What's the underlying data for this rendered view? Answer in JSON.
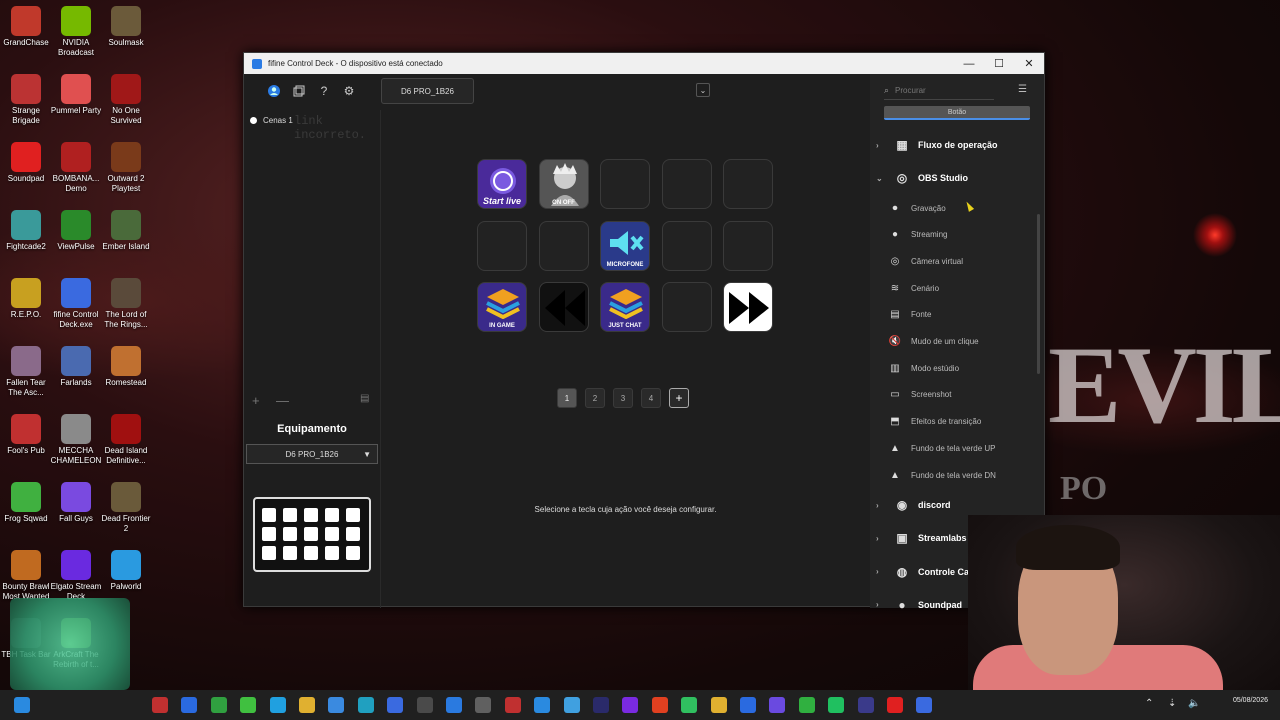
{
  "desktop_icons": [
    {
      "label": "GrandChase",
      "color": "#c0392b"
    },
    {
      "label": "NVIDIA Broadcast",
      "color": "#76b900"
    },
    {
      "label": "Soulmask",
      "color": "#6b5a3a"
    },
    {
      "label": "Strange Brigade",
      "color": "#b33"
    },
    {
      "label": "Pummel Party",
      "color": "#e05050"
    },
    {
      "label": "No One Survived",
      "color": "#a01818"
    },
    {
      "label": "Soundpad",
      "color": "#e02020"
    },
    {
      "label": "BOMBANA... Demo",
      "color": "#b02020"
    },
    {
      "label": "Outward 2 Playtest",
      "color": "#7a3a1a"
    },
    {
      "label": "Fightcade2",
      "color": "#3a9a9a"
    },
    {
      "label": "ViewPulse",
      "color": "#2a8a2a"
    },
    {
      "label": "Ember Island",
      "color": "#4a6a3a"
    },
    {
      "label": "R.E.P.O.",
      "color": "#c8a020"
    },
    {
      "label": "fifine Control Deck.exe",
      "color": "#3a6ae0"
    },
    {
      "label": "The Lord of The Rings...",
      "color": "#5a4a3a"
    },
    {
      "label": "Fallen Tear The Asc...",
      "color": "#8a6a8a"
    },
    {
      "label": "Farlands",
      "color": "#4a6ab0"
    },
    {
      "label": "Romestead",
      "color": "#c07030"
    },
    {
      "label": "Fool's Pub",
      "color": "#c03030"
    },
    {
      "label": "MECCHA CHAMELEON",
      "color": "#8a8a8a"
    },
    {
      "label": "Dead Island Definitive...",
      "color": "#a01010"
    },
    {
      "label": "Frog Sqwad",
      "color": "#40b040"
    },
    {
      "label": "Fall Guys",
      "color": "#7a4ae0"
    },
    {
      "label": "Dead Frontier 2",
      "color": "#6a5a3a"
    },
    {
      "label": "Bounty Brawl Most Wanted",
      "color": "#c06a20"
    },
    {
      "label": "Elgato Stream Deck",
      "color": "#6a2ae0"
    },
    {
      "label": "Palworld",
      "color": "#2a9ae0"
    },
    {
      "label": "TBH Task Bar",
      "color": "#3a3a3a"
    },
    {
      "label": "ArkCraft The Rebirth of t...",
      "color": "#6a9a3a"
    }
  ],
  "window": {
    "title": "fifine Control Deck - O dispositivo está conectado",
    "controls": {
      "minimize": "—",
      "maximize": "☐",
      "close": "✕"
    }
  },
  "toolbar": {
    "icons": [
      "profile-icon",
      "layers-icon",
      "help-icon",
      "settings-icon"
    ],
    "device_tab": "D6 PRO_1B26",
    "dropdown_icon": "chevron-down-icon"
  },
  "scenes": {
    "items": [
      "Cenas 1"
    ],
    "ghost_text": "link incorreto."
  },
  "scene_actions": {
    "add": "+",
    "remove": "—"
  },
  "equipment": {
    "heading": "Equipamento",
    "device": "D6 PRO_1B26"
  },
  "keys": [
    {
      "label": "Start live",
      "color": "#4a2a9a",
      "icon": "obs-icon"
    },
    {
      "label": "ON OFF",
      "color": "#555",
      "icon": "avatar-icon"
    },
    {
      "label": "",
      "color": "",
      "icon": ""
    },
    {
      "label": "",
      "color": "",
      "icon": ""
    },
    {
      "label": "",
      "color": "",
      "icon": ""
    },
    {
      "label": "",
      "color": "",
      "icon": ""
    },
    {
      "label": "",
      "color": "",
      "icon": ""
    },
    {
      "label": "MICROFONE",
      "color": "#2a3a8a",
      "icon": "mute-icon"
    },
    {
      "label": "",
      "color": "",
      "icon": ""
    },
    {
      "label": "",
      "color": "",
      "icon": ""
    },
    {
      "label": "IN GAME",
      "color": "#3a2a8a",
      "icon": "layers-icon"
    },
    {
      "label": "",
      "color": "#111",
      "icon": "rewind-icon"
    },
    {
      "label": "JUST CHAT",
      "color": "#3a2a8a",
      "icon": "layers-icon"
    },
    {
      "label": "",
      "color": "",
      "icon": ""
    },
    {
      "label": "",
      "color": "#fff",
      "icon": "fast-forward-icon"
    }
  ],
  "pager": {
    "pages": [
      "1",
      "2",
      "3",
      "4"
    ],
    "active": 1,
    "add": "+"
  },
  "hint": "Selecione a tecla cuja ação você deseja configurar.",
  "sidebar": {
    "search_placeholder": "Procurar",
    "category_tab": "Botão",
    "groups": [
      {
        "label": "Fluxo de operação",
        "expanded": false,
        "icon": "flow-icon"
      },
      {
        "label": "OBS Studio",
        "expanded": true,
        "icon": "obs-icon"
      }
    ],
    "obs_items": [
      {
        "label": "Gravação",
        "icon": "record-icon"
      },
      {
        "label": "Streaming",
        "icon": "broadcast-icon"
      },
      {
        "label": "Câmera virtual",
        "icon": "camera-icon"
      },
      {
        "label": "Cenário",
        "icon": "layers-icon"
      },
      {
        "label": "Fonte",
        "icon": "source-icon"
      },
      {
        "label": "Mudo de um clique",
        "icon": "mute-icon"
      },
      {
        "label": "Modo estúdio",
        "icon": "studio-icon"
      },
      {
        "label": "Screenshot",
        "icon": "screenshot-icon"
      },
      {
        "label": "Efeitos de transição",
        "icon": "transition-icon"
      },
      {
        "label": "Fundo de tela verde UP",
        "icon": "greenscreen-icon"
      },
      {
        "label": "Fundo de tela verde DN",
        "icon": "greenscreen-icon"
      }
    ],
    "more_groups": [
      {
        "label": "discord",
        "icon": "discord-icon"
      },
      {
        "label": "Streamlabs",
        "icon": "streamlabs-icon"
      },
      {
        "label": "Controle Cam",
        "icon": "camera-control-icon"
      },
      {
        "label": "Soundpad",
        "icon": "soundpad-icon"
      }
    ]
  },
  "background": {
    "title_letters": "EVIL",
    "subtitle_letters": "PO"
  },
  "taskbar": {
    "apps": [
      "#c03030",
      "#2a6ae0",
      "#30a040",
      "#40c040",
      "#20a0e0",
      "#e0b030",
      "#3a8ae0",
      "#20a0c0",
      "#3a6ae0",
      "#4a4a4a",
      "#2a7ae0",
      "#606060",
      "#c03030",
      "#2a8ae0",
      "#40a0e0",
      "#2a2a6a",
      "#7a2ae0",
      "#e04020",
      "#30c060",
      "#e0b030",
      "#2a6ae0",
      "#6a4ae0",
      "#30b040",
      "#20c060",
      "#3a3a8a",
      "#e02020",
      "#3a6ae0"
    ],
    "date": "05/08/2026"
  }
}
